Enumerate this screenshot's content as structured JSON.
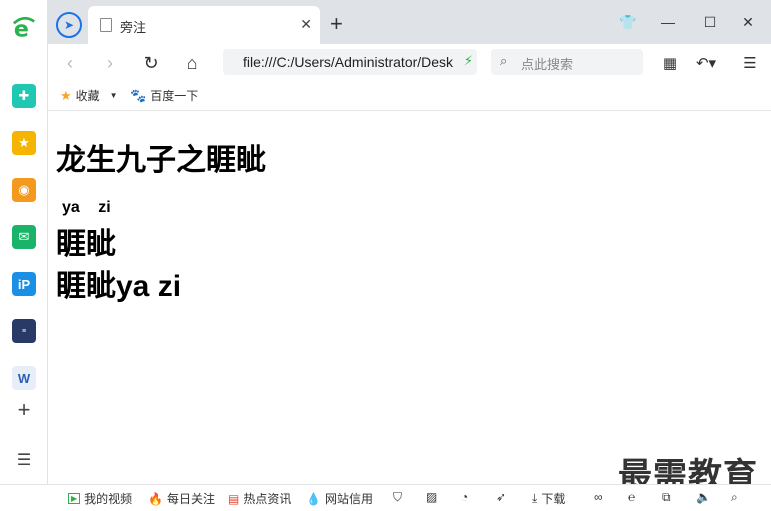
{
  "tab": {
    "title": "旁注"
  },
  "address": {
    "url": "file:///C:/Users/Administrator/Desktop/"
  },
  "search": {
    "placeholder": "点此搜索"
  },
  "bookmarks": {
    "favorites": "收藏",
    "baidu": "百度一下"
  },
  "page": {
    "heading": "龙生九子之睚眦",
    "ruby_1": "ya",
    "ruby_2": "zi",
    "ruby_base": "睚眦",
    "line_plain": "睚眦ya zi"
  },
  "status": {
    "my_video": "我的视频",
    "daily_focus": "每日关注",
    "hot_news": "热点资讯",
    "site_credit": "网站信用",
    "download": "下载"
  },
  "watermark": "最需教育",
  "colors": {
    "accent": "#1a73e8",
    "brand_green": "#2bb24c"
  }
}
